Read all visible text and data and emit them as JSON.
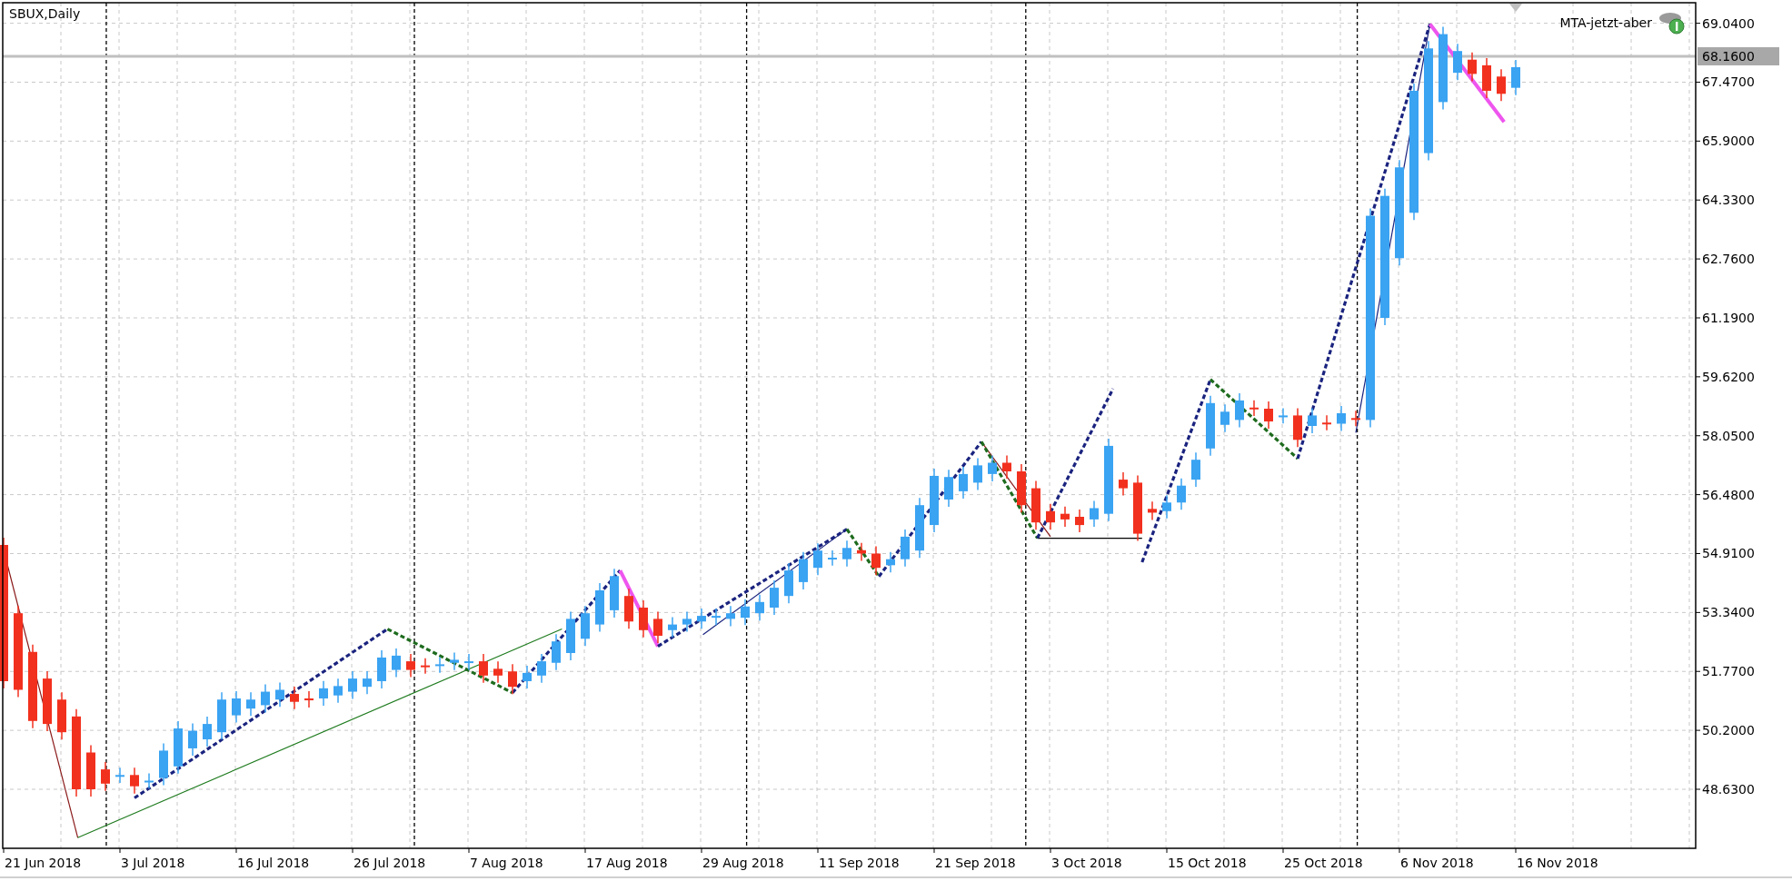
{
  "chart": {
    "title": "SBUX,Daily",
    "indicator": "MTA-jetzt-aber",
    "current_price_label": "68.1600",
    "price_axis": [
      "69.0400",
      "67.4700",
      "65.9000",
      "64.3300",
      "62.7600",
      "61.1900",
      "59.6200",
      "58.0500",
      "56.4800",
      "54.9100",
      "53.3400",
      "51.7700",
      "50.2000",
      "48.6300"
    ],
    "date_axis": [
      "21 Jun 2018",
      "3 Jul 2018",
      "16 Jul 2018",
      "26 Jul 2018",
      "7 Aug 2018",
      "17 Aug 2018",
      "29 Aug 2018",
      "11 Sep 2018",
      "21 Sep 2018",
      "3 Oct 2018",
      "15 Oct 2018",
      "25 Oct 2018",
      "6 Nov 2018",
      "16 Nov 2018"
    ]
  }
}
